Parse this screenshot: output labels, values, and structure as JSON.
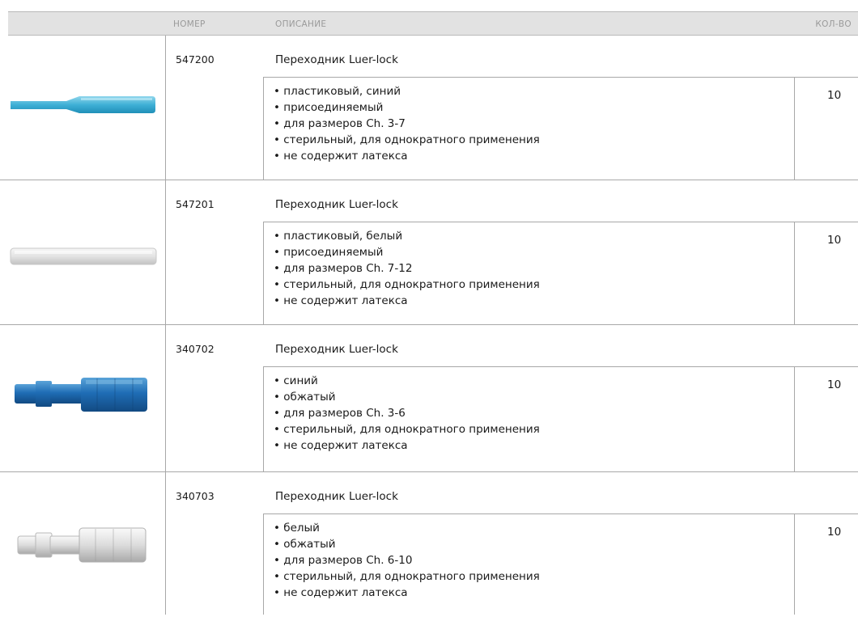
{
  "table": {
    "headers": {
      "number": "НОМЕР",
      "description": "ОПИСАНИЕ",
      "quantity": "КОЛ-ВО"
    },
    "rows": [
      {
        "number": "547200",
        "title": "Переходник Luer-lock",
        "quantity": "10",
        "product_icon": "blue-plastic-tube-adapter",
        "features": [
          "• пластиковый, синий",
          "• присоединяемый",
          "• для размеров Ch. 3-7",
          "• стерильный, для однократного применения",
          "• не содержит латекса"
        ]
      },
      {
        "number": "547201",
        "title": "Переходник Luer-lock",
        "quantity": "10",
        "product_icon": "white-plastic-tube-adapter",
        "features": [
          "• пластиковый, белый",
          "• присоединяемый",
          "• для размеров Ch. 7-12",
          "• стерильный, для однократного применения",
          "• не содержит латекса"
        ]
      },
      {
        "number": "340702",
        "title": "Переходник Luer-lock",
        "quantity": "10",
        "product_icon": "blue-luer-lock-connector",
        "features": [
          "• синий",
          "• обжатый",
          "• для размеров Ch. 3-6",
          "• стерильный, для однократного применения",
          "• не содержит латекса"
        ]
      },
      {
        "number": "340703",
        "title": "Переходник Luer-lock",
        "quantity": "10",
        "product_icon": "white-luer-lock-connector",
        "features": [
          "• белый",
          "• обжатый",
          "• для размеров Ch. 6-10",
          "• стерильный, для однократного применения",
          "• не содержит латекса"
        ]
      }
    ]
  }
}
